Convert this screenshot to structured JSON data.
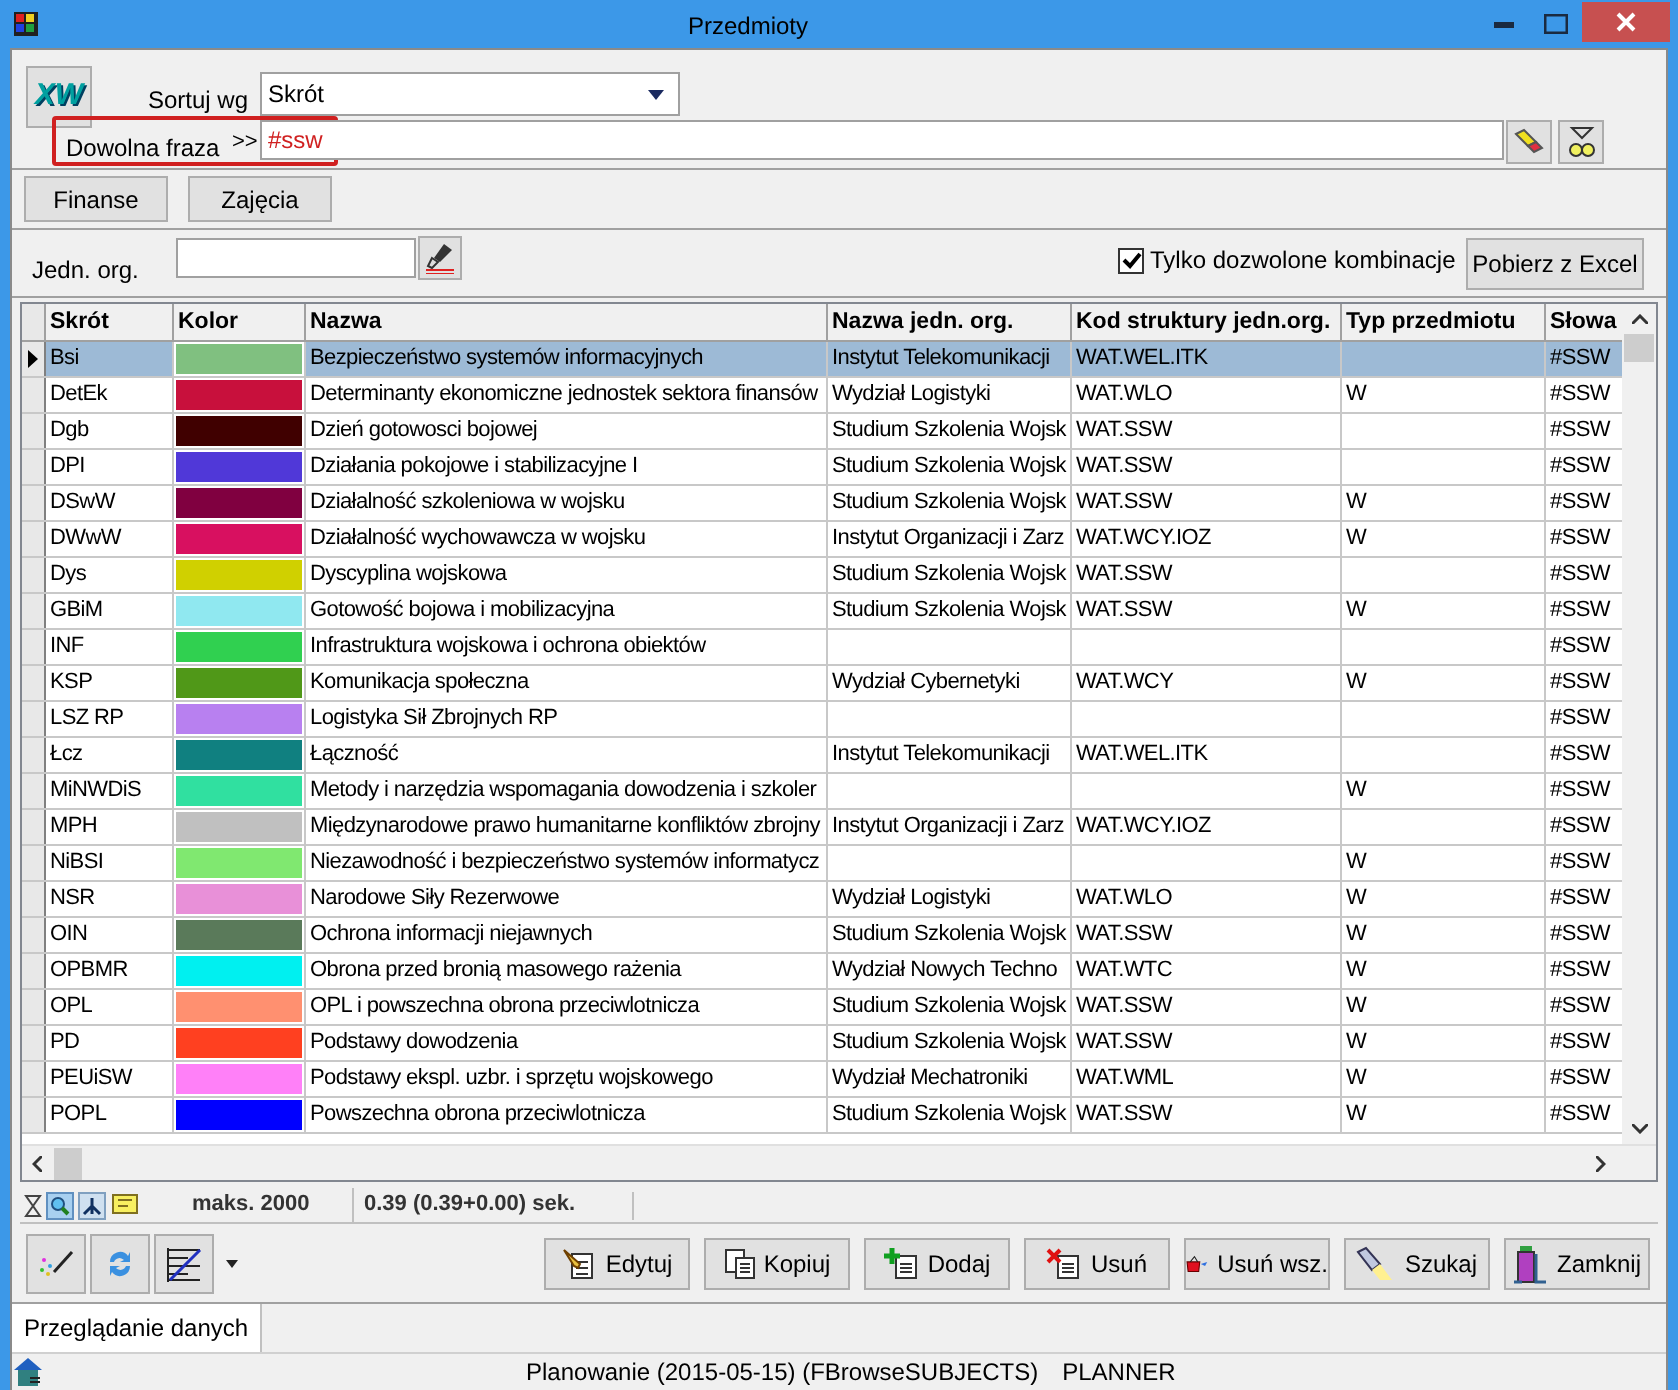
{
  "window": {
    "title": "Przedmioty"
  },
  "logo": "XW",
  "sort": {
    "label": "Sortuj wg",
    "value": "Skrót"
  },
  "search": {
    "label": "Dowolna fraza",
    "arrow": ">>",
    "value": "#ssw"
  },
  "top_buttons": [
    "Finanse",
    "Zajęcia"
  ],
  "org_filter": {
    "label": "Jedn. org."
  },
  "only_allowed": {
    "label": "Tylko dozwolone kombinacje",
    "checked": true
  },
  "excel_button": "Pobierz z Excel",
  "table": {
    "columns": [
      "Skrót",
      "Kolor",
      "Nazwa",
      "Nazwa jedn. org.",
      "Kod struktury jedn.org.",
      "Typ przedmiotu",
      "Słowa"
    ],
    "rows": [
      {
        "abbr": "Bsi",
        "color": "#80c080",
        "name": "Bezpieczeństwo systemów informacyjnych",
        "org": "Instytut Telekomunikacji",
        "code": "WAT.WEL.ITK",
        "type": "",
        "keywords": "#SSW",
        "selected": true
      },
      {
        "abbr": "DetEk",
        "color": "#c8103c",
        "name": "Determinanty ekonomiczne jednostek sektora finansów",
        "org": "Wydział Logistyki",
        "code": "WAT.WLO",
        "type": "W",
        "keywords": "#SSW",
        "selected": false
      },
      {
        "abbr": "Dgb",
        "color": "#400000",
        "name": "Dzień gotowosci bojowej",
        "org": "Studium Szkolenia Wojsk",
        "code": "WAT.SSW",
        "type": "",
        "keywords": "#SSW",
        "selected": false
      },
      {
        "abbr": "DPI",
        "color": "#5038d8",
        "name": "Działania pokojowe i stabilizacyjne I",
        "org": "Studium Szkolenia Wojsk",
        "code": "WAT.SSW",
        "type": "",
        "keywords": "#SSW",
        "selected": false
      },
      {
        "abbr": "DSwW",
        "color": "#800040",
        "name": "Działalność szkoleniowa w wojsku",
        "org": "Studium Szkolenia Wojsk",
        "code": "WAT.SSW",
        "type": "W",
        "keywords": "#SSW",
        "selected": false
      },
      {
        "abbr": "DWwW",
        "color": "#d81060",
        "name": "Działalność wychowawcza w wojsku",
        "org": "Instytut Organizacji i Zarz",
        "code": "WAT.WCY.IOZ",
        "type": "W",
        "keywords": "#SSW",
        "selected": false
      },
      {
        "abbr": "Dys",
        "color": "#d0d000",
        "name": "Dyscyplina wojskowa",
        "org": "Studium Szkolenia Wojsk",
        "code": "WAT.SSW",
        "type": "",
        "keywords": "#SSW",
        "selected": false
      },
      {
        "abbr": "GBiM",
        "color": "#90e8f0",
        "name": "Gotowość bojowa i mobilizacyjna",
        "org": "Studium Szkolenia Wojsk",
        "code": "WAT.SSW",
        "type": "W",
        "keywords": "#SSW",
        "selected": false
      },
      {
        "abbr": "INF",
        "color": "#30d050",
        "name": "Infrastruktura wojskowa i ochrona obiektów",
        "org": "",
        "code": "",
        "type": "",
        "keywords": "#SSW",
        "selected": false
      },
      {
        "abbr": "KSP",
        "color": "#509818",
        "name": "Komunikacja społeczna",
        "org": "Wydział Cybernetyki",
        "code": "WAT.WCY",
        "type": "W",
        "keywords": "#SSW",
        "selected": false
      },
      {
        "abbr": "LSZ RP",
        "color": "#b880f0",
        "name": "Logistyka Sił Zbrojnych RP",
        "org": "",
        "code": "",
        "type": "",
        "keywords": "#SSW",
        "selected": false
      },
      {
        "abbr": "Łcz",
        "color": "#108080",
        "name": "Łączność",
        "org": "Instytut Telekomunikacji",
        "code": "WAT.WEL.ITK",
        "type": "",
        "keywords": "#SSW",
        "selected": false
      },
      {
        "abbr": "MiNWDiS",
        "color": "#30e0a0",
        "name": "Metody i narzędzia wspomagania dowodzenia i szkoler",
        "org": "",
        "code": "",
        "type": "W",
        "keywords": "#SSW",
        "selected": false
      },
      {
        "abbr": "MPH",
        "color": "#c0c0c0",
        "name": "Międzynarodowe prawo humanitarne konfliktów zbrojny",
        "org": "Instytut Organizacji i Zarz",
        "code": "WAT.WCY.IOZ",
        "type": "",
        "keywords": "#SSW",
        "selected": false
      },
      {
        "abbr": "NiBSI",
        "color": "#80e870",
        "name": "Niezawodność i bezpieczeństwo systemów informatycz",
        "org": "",
        "code": "",
        "type": "W",
        "keywords": "#SSW",
        "selected": false
      },
      {
        "abbr": "NSR",
        "color": "#e890d8",
        "name": "Narodowe Siły Rezerwowe",
        "org": "Wydział Logistyki",
        "code": "WAT.WLO",
        "type": "W",
        "keywords": "#SSW",
        "selected": false
      },
      {
        "abbr": "OIN",
        "color": "#5a7a5a",
        "name": "Ochrona informacji niejawnych",
        "org": "Studium Szkolenia Wojsk",
        "code": "WAT.SSW",
        "type": "W",
        "keywords": "#SSW",
        "selected": false
      },
      {
        "abbr": "OPBMR",
        "color": "#00f0f0",
        "name": "Obrona przed bronią masowego rażenia",
        "org": "Wydział Nowych Techno",
        "code": "WAT.WTC",
        "type": "W",
        "keywords": "#SSW",
        "selected": false
      },
      {
        "abbr": "OPL",
        "color": "#ff9070",
        "name": "OPL i powszechna obrona przeciwlotnicza",
        "org": "Studium Szkolenia Wojsk",
        "code": "WAT.SSW",
        "type": "W",
        "keywords": "#SSW",
        "selected": false
      },
      {
        "abbr": "PD",
        "color": "#ff4020",
        "name": "Podstawy dowodzenia",
        "org": "Studium Szkolenia Wojsk",
        "code": "WAT.SSW",
        "type": "W",
        "keywords": "#SSW",
        "selected": false
      },
      {
        "abbr": "PEUiSW",
        "color": "#ff80f8",
        "name": "Podstawy ekspl. uzbr. i sprzętu wojskowego",
        "org": "Wydział Mechatroniki",
        "code": "WAT.WML",
        "type": "W",
        "keywords": "#SSW",
        "selected": false
      },
      {
        "abbr": "POPL",
        "color": "#0000ff",
        "name": "Powszechna obrona przeciwlotnicza",
        "org": "Studium Szkolenia Wojsk",
        "code": "WAT.SSW",
        "type": "W",
        "keywords": "#SSW",
        "selected": false
      }
    ]
  },
  "query_info": {
    "max": "maks. 2000",
    "time": "0.39 (0.39+0.00) sek."
  },
  "actions": [
    {
      "kind": "edit",
      "label": "Edytuj"
    },
    {
      "kind": "copy",
      "label": "Kopiuj"
    },
    {
      "kind": "add",
      "label": "Dodaj"
    },
    {
      "kind": "delete",
      "label": "Usuń"
    },
    {
      "kind": "delete_all",
      "label": "Usuń wsz."
    },
    {
      "kind": "search",
      "label": "Szukaj"
    },
    {
      "kind": "close",
      "label": "Zamknij"
    }
  ],
  "tabs": [
    {
      "label": "Przeglądanie danych",
      "selected": true
    }
  ],
  "status_bar": {
    "text": "Planowanie (2015-05-15) (FBrowseSUBJECTS)",
    "user": "PLANNER"
  }
}
